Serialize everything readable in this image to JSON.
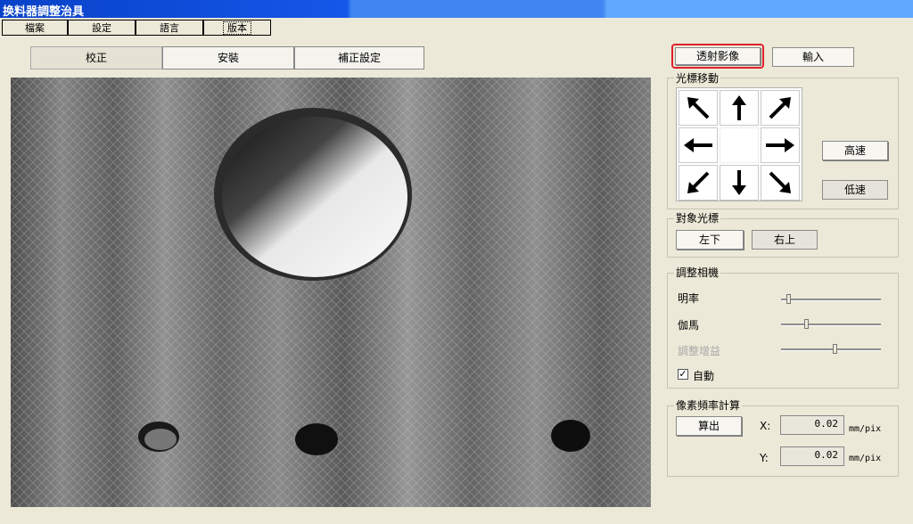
{
  "window": {
    "title": "换料器調整治具"
  },
  "menu": [
    "檔案",
    "設定",
    "語言",
    "版本"
  ],
  "tabs": [
    "校正",
    "安裝",
    "補正設定"
  ],
  "top_buttons": {
    "transmit": "透射影像",
    "input": "輸入"
  },
  "cursor_move": {
    "title": "光標移動",
    "arrows": [
      "arrow-up-left-icon",
      "arrow-up-icon",
      "arrow-up-right-icon",
      "arrow-left-icon",
      "arrow-right-icon",
      "arrow-down-left-icon",
      "arrow-down-icon",
      "arrow-down-right-icon"
    ],
    "fast": "高速",
    "slow": "低速"
  },
  "target_cursor": {
    "title": "對象光標",
    "bottom_left": "左下",
    "top_right": "右上"
  },
  "camera": {
    "title": "調整相機",
    "brightness": {
      "label": "明率",
      "value": 0.05
    },
    "gamma": {
      "label": "伽馬",
      "value": 0.23
    },
    "gain": {
      "label": "調整增益",
      "value": 0.52
    },
    "auto": {
      "label": "自動",
      "checked": true
    }
  },
  "pixel_rate": {
    "title": "像素頻率計算",
    "calc": "算出",
    "x_label": "X:",
    "y_label": "Y:",
    "x_value": "0.02",
    "y_value": "0.02",
    "unit": "mm/pix"
  },
  "colors": {
    "highlight": "#e0202a",
    "titlebar": "#1557e8"
  }
}
